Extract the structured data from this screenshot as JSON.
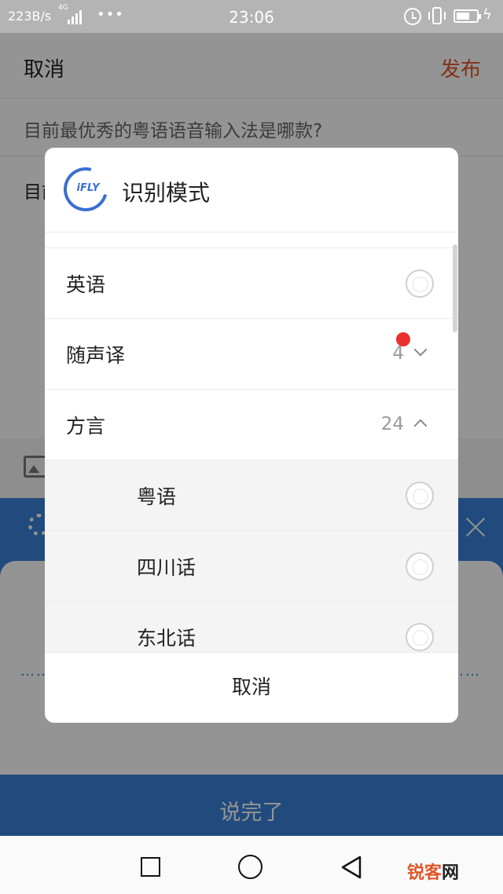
{
  "status_bar": {
    "net_speed": "223B/s",
    "network_type": "4G",
    "time": "23:06",
    "icons": [
      "signal-icon",
      "more-dots-icon",
      "alarm-icon",
      "vibrate-icon",
      "battery-icon",
      "charging-icon"
    ]
  },
  "header": {
    "cancel_label": "取消",
    "publish_label": "发布",
    "publish_color": "#e0562a"
  },
  "question": {
    "text": "目前最优秀的粤语语音输入法是哪款?"
  },
  "editor": {
    "text": "目前"
  },
  "voice_panel": {
    "wave_left": "……",
    "wave_right": "……",
    "done_label": "说完了",
    "accent_color": "#3a82d6"
  },
  "dialog": {
    "logo_text": "iFLY",
    "title": "识别模式",
    "items": [
      {
        "label": "英语",
        "kind": "radio"
      },
      {
        "label": "随声译",
        "kind": "group",
        "count": "4",
        "expanded": false,
        "badge": true
      },
      {
        "label": "方言",
        "kind": "group",
        "count": "24",
        "expanded": true
      },
      {
        "label": "粤语",
        "kind": "sub-radio"
      },
      {
        "label": "四川话",
        "kind": "sub-radio"
      },
      {
        "label": "东北话",
        "kind": "sub-radio"
      }
    ],
    "cancel_label": "取消"
  },
  "nav_bar": {
    "icons": [
      "recent-apps-icon",
      "home-icon",
      "back-icon"
    ],
    "watermark_main": "锐客",
    "watermark_net": "网"
  }
}
